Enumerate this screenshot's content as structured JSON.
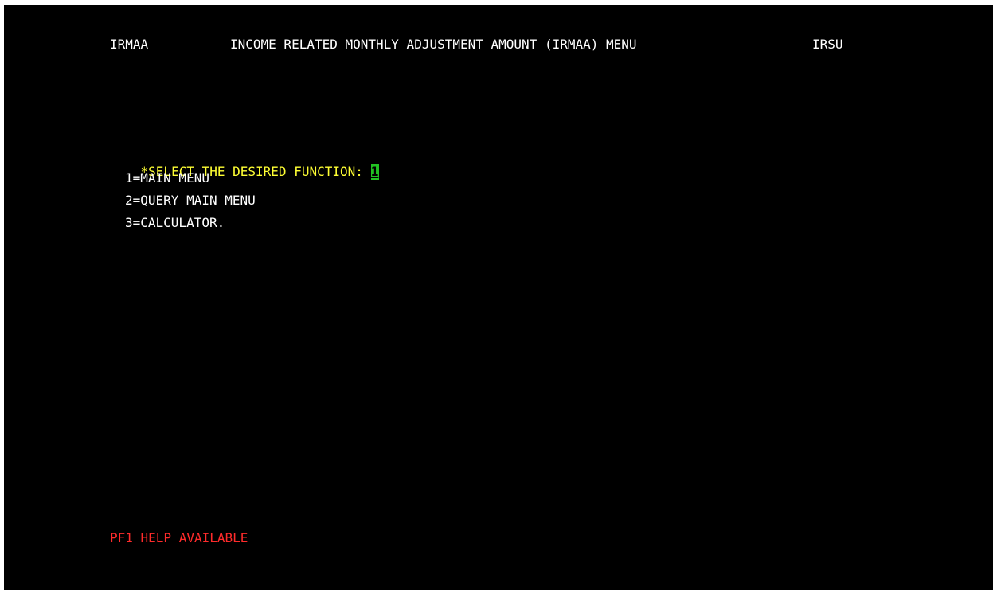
{
  "header": {
    "screen_id": "IRMAA",
    "title": "INCOME RELATED MONTHLY ADJUSTMENT AMOUNT (IRMAA) MENU",
    "system_id": "IRSU"
  },
  "prompt": {
    "label": "*SELECT THE DESIRED FUNCTION:",
    "value": "1"
  },
  "options": [
    "1=MAIN MENU",
    "2=QUERY MAIN MENU",
    "3=CALCULATOR."
  ],
  "footer": {
    "help_text": "PF1 HELP AVAILABLE"
  },
  "colors": {
    "background": "#000000",
    "header_text": "#ffffff",
    "prompt_text": "#ffff33",
    "input_field": "#22c322",
    "help_text": "#ff2b2b"
  }
}
